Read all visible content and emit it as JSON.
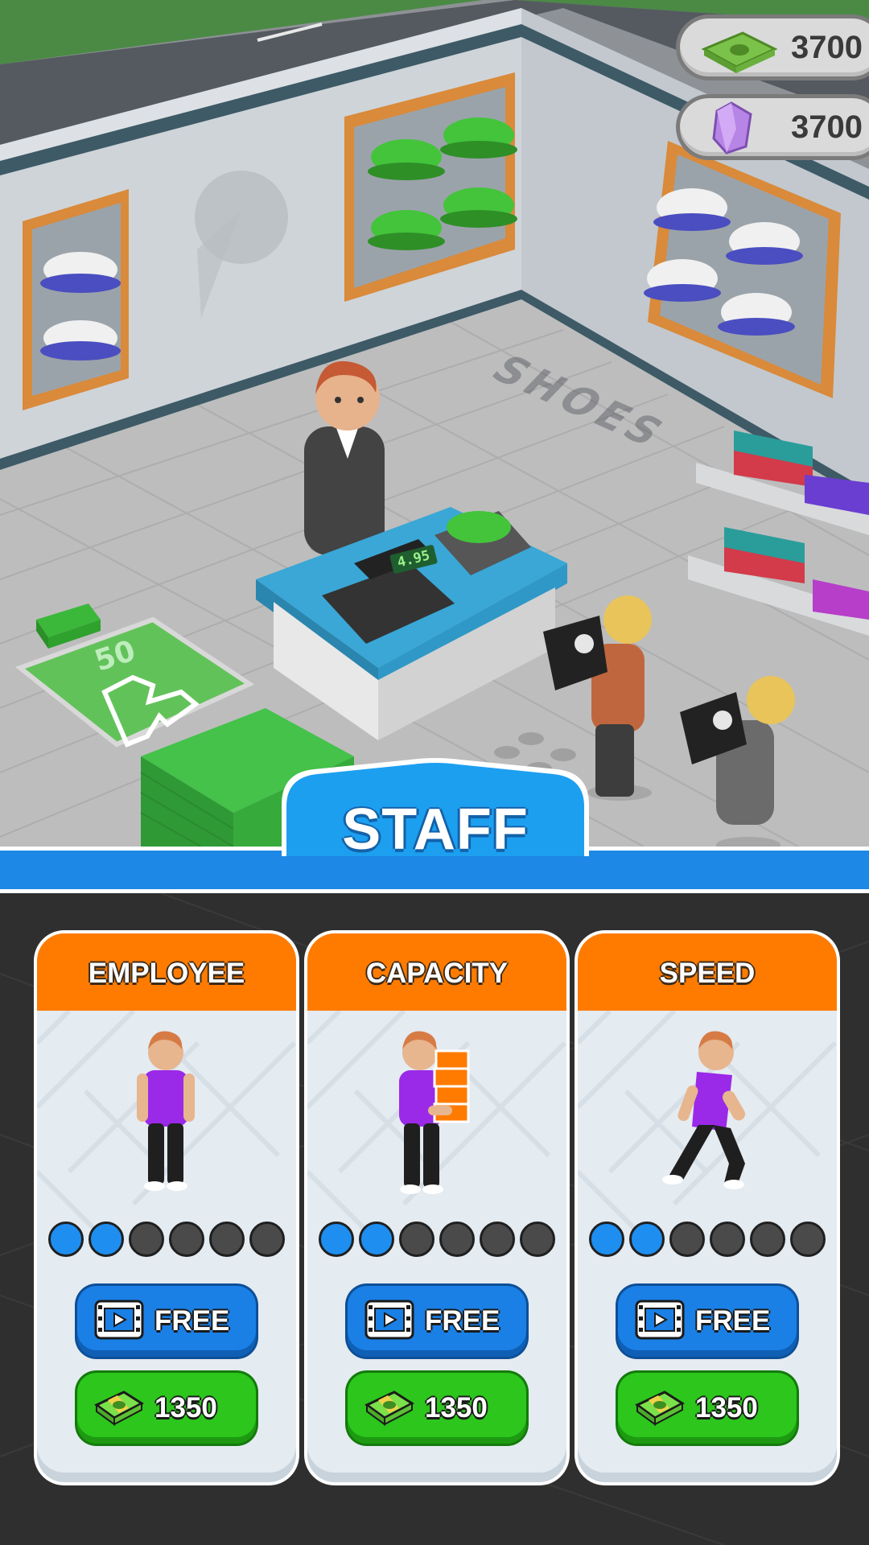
{
  "currency": {
    "cash": "3700",
    "gems": "3700"
  },
  "scene": {
    "floor_label": "SHOES",
    "mat_number": "50",
    "price_tag": "4.95"
  },
  "header": {
    "title": "STAFF"
  },
  "cards": [
    {
      "title": "EMPLOYEE",
      "level": 2,
      "max_level": 6,
      "free_label": "FREE",
      "price": "1350"
    },
    {
      "title": "CAPACITY",
      "level": 2,
      "max_level": 6,
      "free_label": "FREE",
      "price": "1350"
    },
    {
      "title": "SPEED",
      "level": 2,
      "max_level": 6,
      "free_label": "FREE",
      "price": "1350"
    }
  ],
  "icons": {
    "cash": "cash-stack-icon",
    "gem": "purple-gem-icon",
    "video": "video-ad-icon"
  },
  "colors": {
    "accent_blue": "#1d88e5",
    "card_header": "#ff7b00",
    "buy_green": "#2cc61c",
    "level_on": "#1e8ef0",
    "level_off": "#4a4a4a"
  }
}
